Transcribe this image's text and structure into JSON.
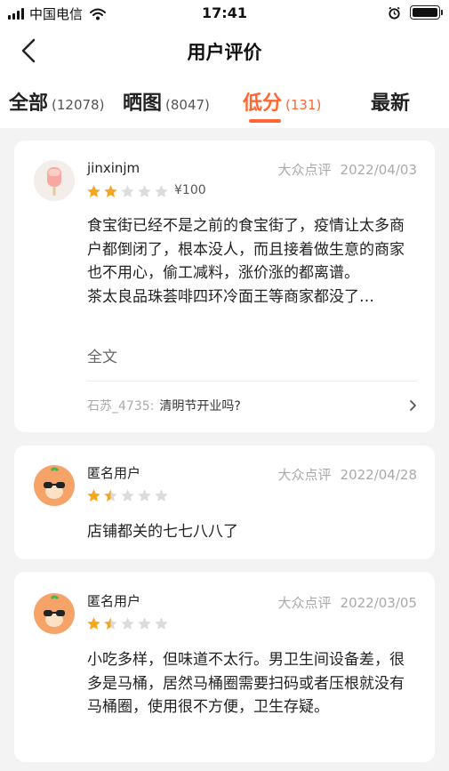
{
  "status_bar": {
    "carrier": "中国电信",
    "time": "17:41"
  },
  "header": {
    "title": "用户评价"
  },
  "tabs": [
    {
      "label": "全部",
      "count": "(12078)"
    },
    {
      "label": "晒图",
      "count": "(8047)"
    },
    {
      "label": "低分",
      "count": "(131)"
    },
    {
      "label": "最新",
      "count": ""
    }
  ],
  "active_tab": "低分",
  "colors": {
    "accent": "#ff6633",
    "star_filled": "#f5a623",
    "star_empty": "#dcdcdc"
  },
  "reviews": [
    {
      "user": "jinxinjm",
      "source": "大众点评",
      "date": "2022/04/03",
      "rating": 2,
      "price": "¥100",
      "text": "食宝街已经不是之前的食宝街了，疫情让太多商户都倒闭了，根本没人，而且接着做生意的商家也不用心，偷工减料，涨价涨的都离谱。",
      "text2": "茶太良品珠荟啡四环冷面王等商家都没了…",
      "more_label": "全文",
      "qa_user": "石苏_4735:",
      "qa_text": "清明节开业吗?"
    },
    {
      "user": "匿名用户",
      "source": "大众点评",
      "date": "2022/04/28",
      "rating": 1.5,
      "text": "店铺都关的七七八八了"
    },
    {
      "user": "匿名用户",
      "source": "大众点评",
      "date": "2022/03/05",
      "rating": 1.5,
      "text": "小吃多样，但味道不太行。男卫生间设备差，很多是马桶，居然马桶圈需要扫码或者压根就没有马桶圈，使用很不方便，卫生存疑。"
    }
  ]
}
